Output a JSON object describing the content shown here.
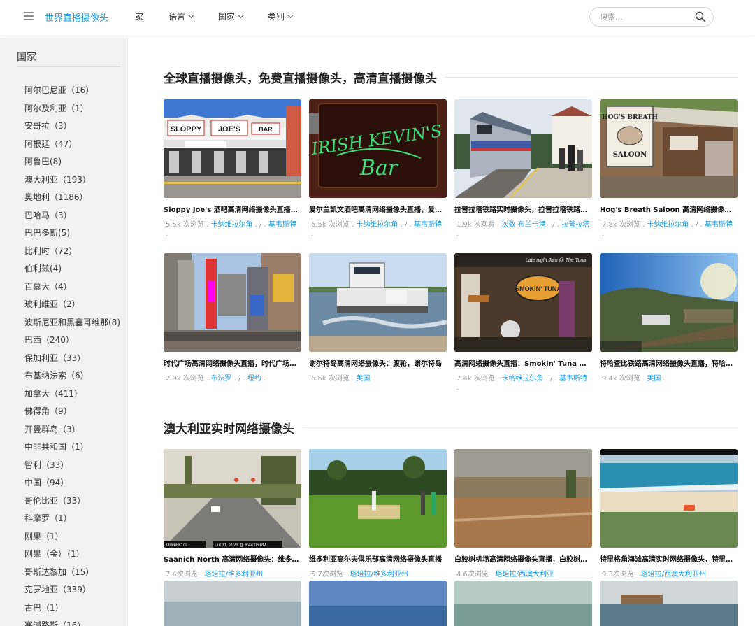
{
  "header": {
    "logo": "世界直播摄像头",
    "nav": [
      {
        "label": "家",
        "dropdown": false
      },
      {
        "label": "语言",
        "dropdown": true
      },
      {
        "label": "国家",
        "dropdown": true
      },
      {
        "label": "类别",
        "dropdown": true
      }
    ],
    "search_placeholder": "搜索..."
  },
  "sidebar": {
    "title": "国家",
    "countries": [
      "阿尔巴尼亚（16）",
      "阿尔及利亚（1）",
      "安哥拉（3）",
      "阿根廷（47）",
      "阿鲁巴(8)",
      "澳大利亚（193）",
      "奥地利（1186）",
      "巴哈马（3）",
      "巴巴多斯(5)",
      "比利时（72）",
      "伯利兹(4)",
      "百慕大（4）",
      "玻利维亚（2）",
      "波斯尼亚和黑塞哥维那(8)",
      "巴西（240）",
      "保加利亚（33）",
      "布基纳法索（6）",
      "加拿大（411）",
      "佛得角（9）",
      "开曼群岛（3）",
      "中非共和国（1）",
      "智利（33）",
      "中国（94）",
      "哥伦比亚（33）",
      "科摩罗（1）",
      "刚果（1）",
      "刚果（金）（1）",
      "哥斯达黎加（15）",
      "克罗地亚（339）",
      "古巴（1）",
      "塞浦路斯（16）"
    ]
  },
  "sections": [
    {
      "title": "全球直播摄像头，免费直播摄像头，高清直播摄像头",
      "cards": [
        {
          "title": "Sloppy Joe's 酒吧高清网络摄像头直播，基韦斯特",
          "views": "5.5k 次浏览",
          "tags": [
            "卡纳维拉尔角",
            "基韦斯特"
          ],
          "tail": "."
        },
        {
          "title": "爱尔兰凯文酒吧高清网络摄像头直播，爱尔兰凯文酒吧",
          "views": "6.5k 次浏览",
          "tags": [
            "卡纳维拉尔角",
            "基韦斯特"
          ],
          "tail": "."
        },
        {
          "title": "拉普拉塔铁路实时摄像头，拉普拉塔铁路网络摄像头",
          "views": "1.9k 次观看",
          "tags": [
            "次数 布兰卡港",
            "拉普拉塔"
          ],
          "tail": "."
        },
        {
          "title": "Hog's Breath Saloon 高清网络摄像头直播",
          "views": "7.8k 次浏览",
          "tags": [
            "卡纳维拉尔角",
            "基韦斯特"
          ],
          "tail": "."
        },
        {
          "title": "时代广场高清网络摄像头直播，时代广场网络摄像头",
          "views": "2.9k 次浏览",
          "tags": [
            "布法罗",
            "纽约"
          ],
          "tail": ""
        },
        {
          "title": "谢尔特岛高清网络摄像头：渡轮，谢尔特岛",
          "views": "6.6k 次浏览",
          "tags": [
            "美国"
          ],
          "tail": ""
        },
        {
          "title": "高清网络摄像头直播：Smokin' Tuna 酒吧",
          "views": "7.4k 次浏览",
          "tags": [
            "卡纳维拉尔角",
            "基韦斯特"
          ],
          "tail": "."
        },
        {
          "title": "特哈查比铁路高清网络摄像头直播，特哈查比铁路",
          "views": "9.4k 次浏览",
          "tags": [
            "美国"
          ],
          "tail": ""
        }
      ]
    },
    {
      "title": "澳大利亚实时网络摄像头",
      "cards": [
        {
          "title": "Saanich North 高清网络摄像头：维多利亚州",
          "views": "7.4次浏览",
          "tags": [
            "塔培拉/维多利亚州"
          ],
          "tail": ""
        },
        {
          "title": "维多利亚高尔夫俱乐部高清网络摄像头直播",
          "views": "5.7次浏览",
          "tags": [
            "塔培拉/维多利亚州"
          ],
          "tail": ""
        },
        {
          "title": "白胶树机场高清网络摄像头直播，白胶树机场",
          "views": "4.6次浏览",
          "tags": [
            "塔培拉/西澳大利亚"
          ],
          "tail": ""
        },
        {
          "title": "特里格角海滩高清实时网络摄像头，特里格角海滩",
          "views": "9.3次浏览",
          "tags": [
            "塔培拉/西澳大利亚州"
          ],
          "tail": ""
        }
      ]
    }
  ],
  "scene_labels": {
    "sloppy": "SLOPPY JOE'S",
    "bar": "BAR",
    "irish1": "IRISH KEVIN'S",
    "irish2": "Bar",
    "hogs1": "HOG'S BREATH",
    "hogs2": "SALOON",
    "smokin": "SMOKIN' TUNA",
    "latenight": "Late night Jam @ The Tuna",
    "drivebc": "DriveBC.ca",
    "datestamp": "Jul 31, 2023 @ 6:44:06 PM"
  }
}
